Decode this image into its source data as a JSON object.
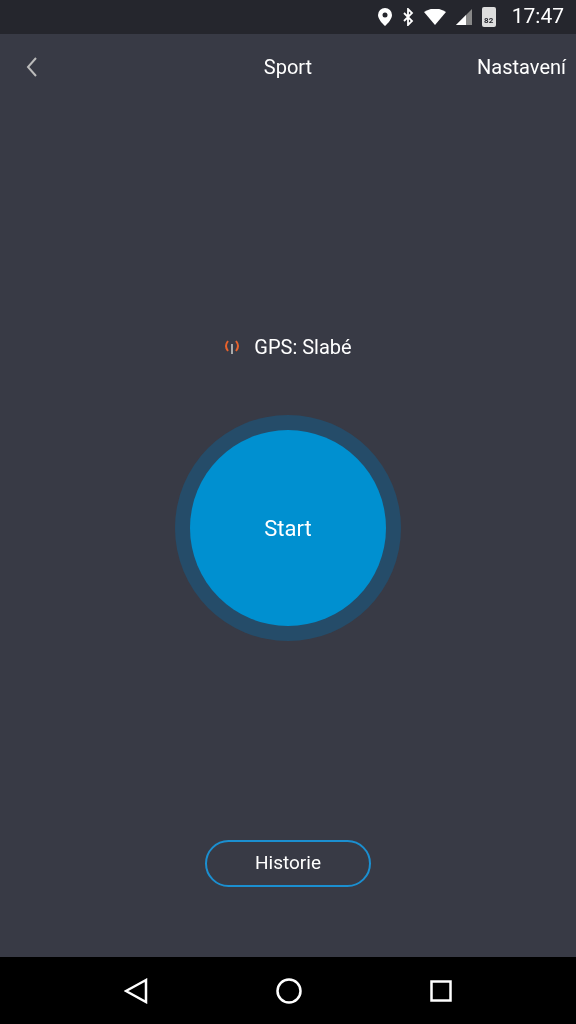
{
  "status_bar": {
    "battery": "82",
    "time": "17:47"
  },
  "header": {
    "title": "Sport",
    "action": "Nastavení"
  },
  "gps": {
    "label": "GPS: Slabé",
    "color": "#e8622c"
  },
  "start_button": {
    "label": "Start"
  },
  "history_button": {
    "label": "Historie"
  }
}
